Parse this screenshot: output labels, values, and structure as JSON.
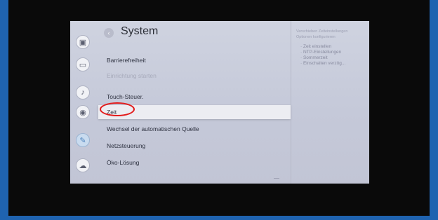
{
  "settings": {
    "title": "System",
    "menu": [
      {
        "label": "Barrierefreiheit"
      },
      {
        "label": "Einrichtung starten"
      },
      {
        "label": "Touch-Steuer."
      },
      {
        "label": "Zeit"
      },
      {
        "label": "Wechsel der automatischen Quelle"
      },
      {
        "label": "Netzsteuerung"
      },
      {
        "label": "Öko-Lösung"
      }
    ],
    "info": {
      "line1": "Verschieben Zeiteinstellungen",
      "line2": "Optionen konfigurieren",
      "items": [
        "· Zeit einstellen",
        "· NTP-Einstellungen",
        "· Sommerzeit",
        "· Einschalten verzög..."
      ]
    }
  },
  "rail_icons": [
    "picture-icon",
    "source-icon",
    "sound-icon",
    "broadcast-icon",
    "tools-icon",
    "support-icon"
  ],
  "colors": {
    "frame": "#1f63b0",
    "highlight": "#e31c1c",
    "active_icon": "#4e83bd"
  }
}
